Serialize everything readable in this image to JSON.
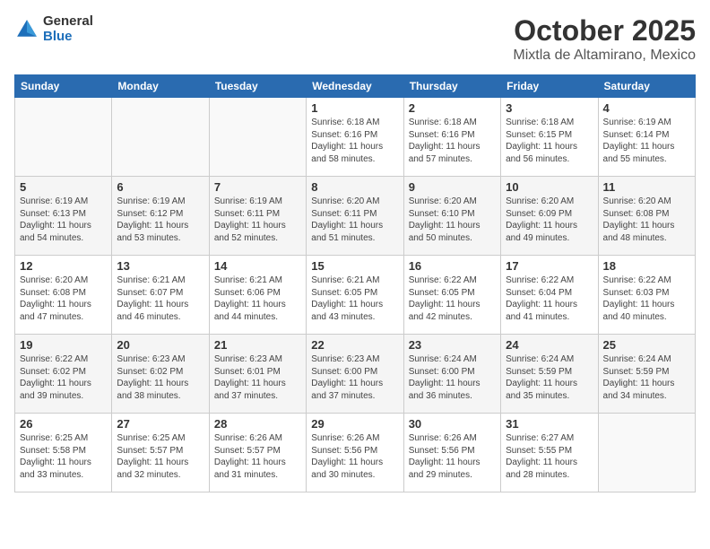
{
  "header": {
    "logo_general": "General",
    "logo_blue": "Blue",
    "month": "October 2025",
    "location": "Mixtla de Altamirano, Mexico"
  },
  "weekdays": [
    "Sunday",
    "Monday",
    "Tuesday",
    "Wednesday",
    "Thursday",
    "Friday",
    "Saturday"
  ],
  "weeks": [
    [
      {
        "day": "",
        "info": ""
      },
      {
        "day": "",
        "info": ""
      },
      {
        "day": "",
        "info": ""
      },
      {
        "day": "1",
        "info": "Sunrise: 6:18 AM\nSunset: 6:16 PM\nDaylight: 11 hours\nand 58 minutes."
      },
      {
        "day": "2",
        "info": "Sunrise: 6:18 AM\nSunset: 6:16 PM\nDaylight: 11 hours\nand 57 minutes."
      },
      {
        "day": "3",
        "info": "Sunrise: 6:18 AM\nSunset: 6:15 PM\nDaylight: 11 hours\nand 56 minutes."
      },
      {
        "day": "4",
        "info": "Sunrise: 6:19 AM\nSunset: 6:14 PM\nDaylight: 11 hours\nand 55 minutes."
      }
    ],
    [
      {
        "day": "5",
        "info": "Sunrise: 6:19 AM\nSunset: 6:13 PM\nDaylight: 11 hours\nand 54 minutes."
      },
      {
        "day": "6",
        "info": "Sunrise: 6:19 AM\nSunset: 6:12 PM\nDaylight: 11 hours\nand 53 minutes."
      },
      {
        "day": "7",
        "info": "Sunrise: 6:19 AM\nSunset: 6:11 PM\nDaylight: 11 hours\nand 52 minutes."
      },
      {
        "day": "8",
        "info": "Sunrise: 6:20 AM\nSunset: 6:11 PM\nDaylight: 11 hours\nand 51 minutes."
      },
      {
        "day": "9",
        "info": "Sunrise: 6:20 AM\nSunset: 6:10 PM\nDaylight: 11 hours\nand 50 minutes."
      },
      {
        "day": "10",
        "info": "Sunrise: 6:20 AM\nSunset: 6:09 PM\nDaylight: 11 hours\nand 49 minutes."
      },
      {
        "day": "11",
        "info": "Sunrise: 6:20 AM\nSunset: 6:08 PM\nDaylight: 11 hours\nand 48 minutes."
      }
    ],
    [
      {
        "day": "12",
        "info": "Sunrise: 6:20 AM\nSunset: 6:08 PM\nDaylight: 11 hours\nand 47 minutes."
      },
      {
        "day": "13",
        "info": "Sunrise: 6:21 AM\nSunset: 6:07 PM\nDaylight: 11 hours\nand 46 minutes."
      },
      {
        "day": "14",
        "info": "Sunrise: 6:21 AM\nSunset: 6:06 PM\nDaylight: 11 hours\nand 44 minutes."
      },
      {
        "day": "15",
        "info": "Sunrise: 6:21 AM\nSunset: 6:05 PM\nDaylight: 11 hours\nand 43 minutes."
      },
      {
        "day": "16",
        "info": "Sunrise: 6:22 AM\nSunset: 6:05 PM\nDaylight: 11 hours\nand 42 minutes."
      },
      {
        "day": "17",
        "info": "Sunrise: 6:22 AM\nSunset: 6:04 PM\nDaylight: 11 hours\nand 41 minutes."
      },
      {
        "day": "18",
        "info": "Sunrise: 6:22 AM\nSunset: 6:03 PM\nDaylight: 11 hours\nand 40 minutes."
      }
    ],
    [
      {
        "day": "19",
        "info": "Sunrise: 6:22 AM\nSunset: 6:02 PM\nDaylight: 11 hours\nand 39 minutes."
      },
      {
        "day": "20",
        "info": "Sunrise: 6:23 AM\nSunset: 6:02 PM\nDaylight: 11 hours\nand 38 minutes."
      },
      {
        "day": "21",
        "info": "Sunrise: 6:23 AM\nSunset: 6:01 PM\nDaylight: 11 hours\nand 37 minutes."
      },
      {
        "day": "22",
        "info": "Sunrise: 6:23 AM\nSunset: 6:00 PM\nDaylight: 11 hours\nand 37 minutes."
      },
      {
        "day": "23",
        "info": "Sunrise: 6:24 AM\nSunset: 6:00 PM\nDaylight: 11 hours\nand 36 minutes."
      },
      {
        "day": "24",
        "info": "Sunrise: 6:24 AM\nSunset: 5:59 PM\nDaylight: 11 hours\nand 35 minutes."
      },
      {
        "day": "25",
        "info": "Sunrise: 6:24 AM\nSunset: 5:59 PM\nDaylight: 11 hours\nand 34 minutes."
      }
    ],
    [
      {
        "day": "26",
        "info": "Sunrise: 6:25 AM\nSunset: 5:58 PM\nDaylight: 11 hours\nand 33 minutes."
      },
      {
        "day": "27",
        "info": "Sunrise: 6:25 AM\nSunset: 5:57 PM\nDaylight: 11 hours\nand 32 minutes."
      },
      {
        "day": "28",
        "info": "Sunrise: 6:26 AM\nSunset: 5:57 PM\nDaylight: 11 hours\nand 31 minutes."
      },
      {
        "day": "29",
        "info": "Sunrise: 6:26 AM\nSunset: 5:56 PM\nDaylight: 11 hours\nand 30 minutes."
      },
      {
        "day": "30",
        "info": "Sunrise: 6:26 AM\nSunset: 5:56 PM\nDaylight: 11 hours\nand 29 minutes."
      },
      {
        "day": "31",
        "info": "Sunrise: 6:27 AM\nSunset: 5:55 PM\nDaylight: 11 hours\nand 28 minutes."
      },
      {
        "day": "",
        "info": ""
      }
    ]
  ]
}
